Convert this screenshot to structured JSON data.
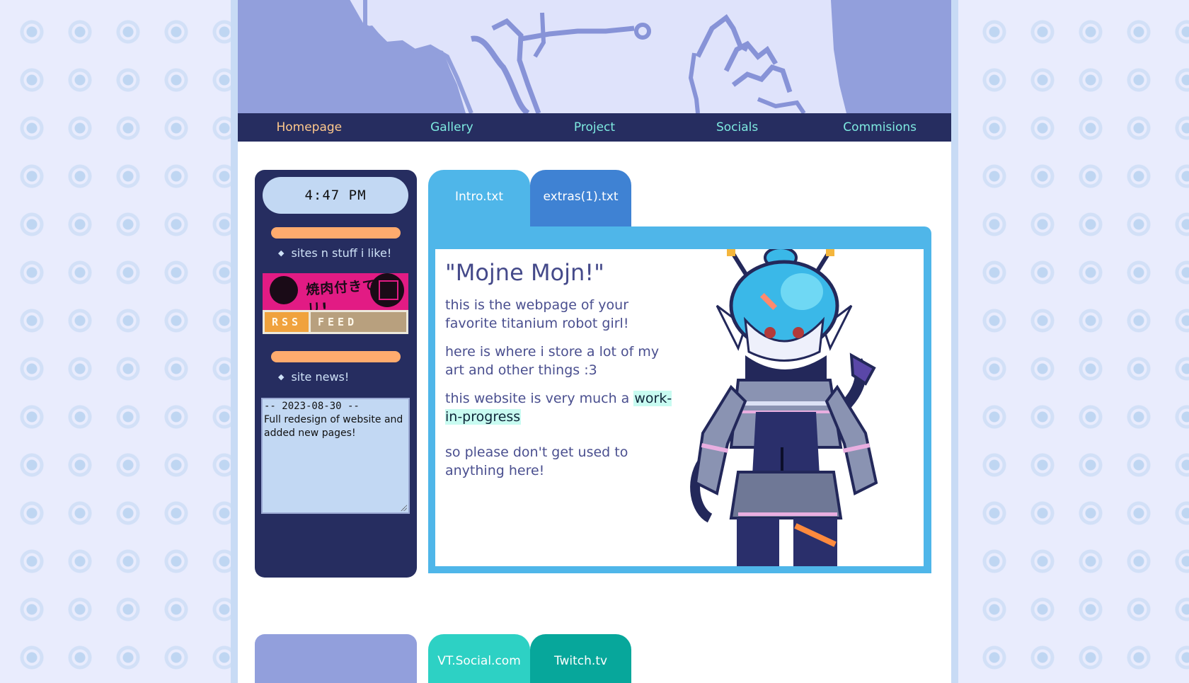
{
  "nav": {
    "items": [
      {
        "label": "Homepage",
        "active": true
      },
      {
        "label": "Gallery"
      },
      {
        "label": "Project"
      },
      {
        "label": "Socials"
      },
      {
        "label": "Commisions"
      }
    ]
  },
  "sidebar": {
    "clock": "4:47 PM",
    "sites_label": "sites n stuff i like!",
    "button_jp": "焼肉付きでゲリ!",
    "rss_left": "RSS",
    "rss_right": "FEED",
    "news_label": "site news!",
    "news": {
      "date": "-- 2023-08-30 --",
      "text": "Full redesign of website and added new pages!"
    }
  },
  "tabs": {
    "intro": "Intro.txt",
    "extras": "extras(1).txt"
  },
  "content": {
    "title": "\"Mojne Mojn!\"",
    "p1": "this is the webpage of your favorite titanium robot girl!",
    "p2": "here is where i store a lot of my art and other things :3",
    "p3_pre": "this website is very much a ",
    "p3_highlight": "work-in-progress",
    "p4": "so please don't get used to anything here!"
  },
  "bottom_tabs": {
    "vt": "VT.Social.com",
    "twitch": "Twitch.tv"
  },
  "colors": {
    "nav_bg": "#262d60",
    "nav_text": "#7eeae0",
    "nav_active": "#ffc98c",
    "tab_blue": "#4fb6e9",
    "tab_dark_blue": "#3f82d3",
    "accent_orange": "#ffab6e",
    "teal": "#2dd1c4",
    "dark_teal": "#07a79b"
  }
}
